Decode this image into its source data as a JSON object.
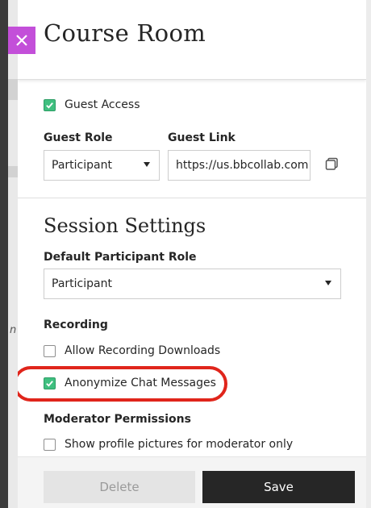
{
  "panel": {
    "title": "Course Room"
  },
  "guest": {
    "access_label": "Guest Access",
    "access_checked": true,
    "role_label": "Guest Role",
    "role_value": "Participant",
    "link_label": "Guest Link",
    "link_value": "https://us.bbcollab.com"
  },
  "session": {
    "title": "Session Settings",
    "default_role_label": "Default Participant Role",
    "default_role_value": "Participant",
    "recording_label": "Recording",
    "allow_downloads_label": "Allow Recording Downloads",
    "allow_downloads_checked": false,
    "anonymize_label": "Anonymize Chat Messages",
    "anonymize_checked": true,
    "moderator_label": "Moderator Permissions",
    "profile_pictures_label": "Show profile pictures for moderator only",
    "profile_pictures_checked": false
  },
  "footer": {
    "delete_label": "Delete",
    "save_label": "Save"
  },
  "background": {
    "partial_char": "n"
  },
  "colors": {
    "accent_close": "#c34fd9",
    "check_green": "#3fbf7f",
    "highlight_red": "#e0251b",
    "save_dark": "#262626"
  }
}
